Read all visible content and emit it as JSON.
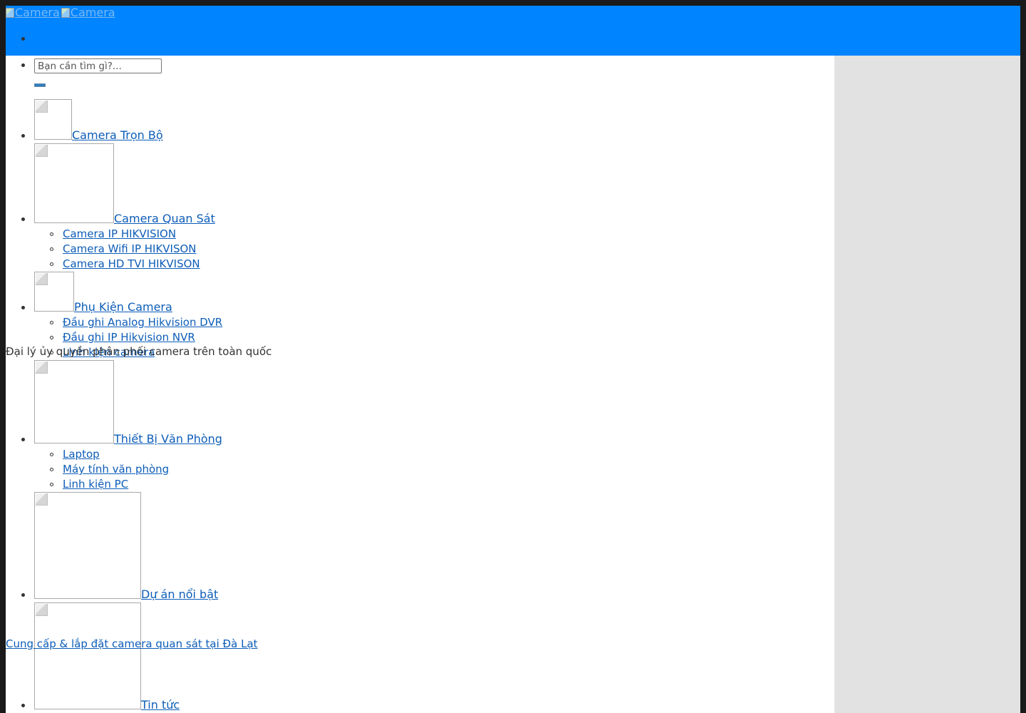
{
  "header": {
    "logo_alt_1": "Camera",
    "logo_alt_2": "Camera"
  },
  "search": {
    "placeholder": "Bạn cần tìm gì?..."
  },
  "menu": {
    "items": [
      {
        "label": "Camera Trọn Bộ",
        "children": []
      },
      {
        "label": "Camera Quan Sát",
        "children": [
          "Camera IP HIKVISION",
          "Camera Wifi IP HIKVISON",
          "Camera HD TVI HIKVISON"
        ]
      },
      {
        "label": "Phụ Kiện Camera",
        "children": [
          "Đầu ghi Analog Hikvision DVR",
          "Đầu ghi IP Hikvision NVR",
          "Linh kiện camera"
        ]
      },
      {
        "label": "Thiết Bị Văn Phòng",
        "children": [
          "Laptop",
          "Máy tính văn phòng",
          "Linh kiện PC"
        ]
      },
      {
        "label": "Dự án nổi bật",
        "children": []
      },
      {
        "label": "Tin tức",
        "children": []
      }
    ]
  },
  "tagline": "Đại lý ủy quyền phân phối camera trên toàn quốc",
  "subtitle": "Cung cấp & lắp đặt camera quan sát tại Đà Lạt",
  "colors": {
    "header_bg": "#0084ff",
    "sidebar_bg": "#e2e2e2",
    "link": "#0d5db8"
  }
}
